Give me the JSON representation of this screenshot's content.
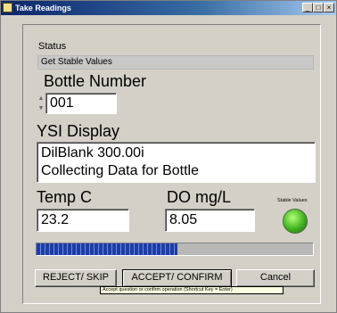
{
  "window": {
    "title": "Take Readings",
    "minimize_glyph": "_",
    "maximize_glyph": "□",
    "close_glyph": "×"
  },
  "status": {
    "label": "Status",
    "value": "Get Stable Values"
  },
  "bottle": {
    "label": "Bottle Number",
    "value": "001"
  },
  "ysi": {
    "label": "YSI Display",
    "line1": "DilBlank 300.00i",
    "line2": "Collecting Data for Bottle"
  },
  "temp": {
    "label": "Temp C",
    "value": "23.2"
  },
  "do": {
    "label": "DO mg/L",
    "value": "8.05"
  },
  "stable": {
    "label": "Stable Values",
    "indicator_color": "#3fb21f"
  },
  "progress": {
    "fraction": 0.51,
    "color": "#1d3ea8"
  },
  "buttons": {
    "reject": "REJECT/ SKIP",
    "accept": "ACCEPT/ CONFIRM",
    "cancel": "Cancel"
  },
  "tooltip": "Accept question or confirm operation (Shortcut Key = Enter)"
}
